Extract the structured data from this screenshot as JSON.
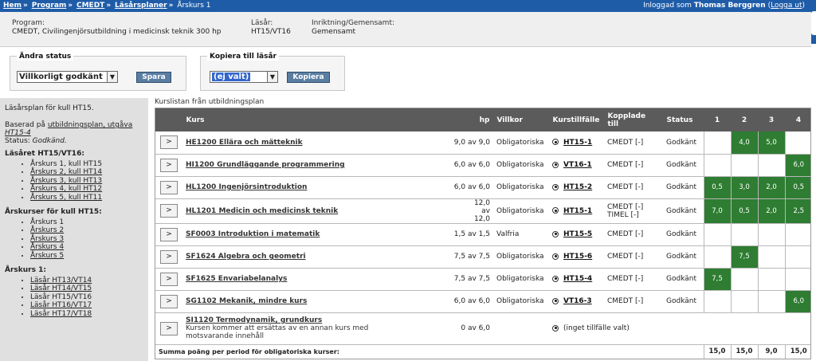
{
  "breadcrumb": {
    "home": "Hem",
    "program": "Program",
    "cmedt": "CMEDT",
    "plans": "Läsårsplaner",
    "current": "Årskurs 1",
    "separator": "»"
  },
  "login": {
    "prefix": "Inloggad som",
    "user": "Thomas Berggren",
    "logout": "Logga ut"
  },
  "info": {
    "program_label": "Program:",
    "program_value": "CMEDT, Civilingenjörsutbildning i medicinsk teknik 300 hp",
    "year_label": "Läsår:",
    "year_value": "HT15/VT16",
    "direction_label": "Inriktning/Gemensamt:",
    "direction_value": "Gemensamt"
  },
  "status_box": {
    "legend": "Ändra status",
    "selected": "Villkorligt godkänt",
    "button": "Spara"
  },
  "copy_box": {
    "legend": "Kopiera till läsår",
    "selected": "(ej valt)",
    "button": "Kopiera"
  },
  "sidebar": {
    "plan_for": "Läsårsplan för kull HT15.",
    "based_on": "Baserad på",
    "based_link": "utbildningsplan, utgåva",
    "based_version": "HT15-4",
    "status_label": "Status:",
    "status_value": "Godkänd.",
    "year_heading": "Läsåret HT15/VT16:",
    "year_items": [
      "Årskurs 1, kull HT15",
      "Årskurs 2, kull HT14",
      "Årskurs 3, kull HT13",
      "Årskurs 4, kull HT12",
      "Årskurs 5, kull HT11"
    ],
    "class_heading": "Årskurser för kull HT15:",
    "class_items": [
      "Årskurs 1",
      "Årskurs 2",
      "Årskurs 3",
      "Årskurs 4",
      "Årskurs 5"
    ],
    "ak1_heading": "Årskurs 1:",
    "ak1_items": [
      "Läsår HT13/VT14",
      "Läsår HT14/VT15",
      "Läsår HT15/VT16",
      "Läsår HT16/VT17",
      "Läsår HT17/VT18"
    ]
  },
  "main": {
    "title": "Kurslistan från utbildningsplan",
    "headers": {
      "kurs": "Kurs",
      "hp": "hp",
      "villkor": "Villkor",
      "tillfalle": "Kurstillfälle",
      "kopplade_1": "Kopplade",
      "kopplade_2": "till",
      "status": "Status",
      "p1": "1",
      "p2": "2",
      "p3": "3",
      "p4": "4"
    },
    "expand_label": ">",
    "rows": [
      {
        "code": "HE1200 Ellära och mätteknik",
        "hp": "9,0 av 9,0",
        "villkor": "Obligatoriska",
        "tillfalle": "HT15-1",
        "kopplade": "CMEDT [-]",
        "status": "Godkänt",
        "p": [
          "",
          "4,0",
          "5,0",
          ""
        ]
      },
      {
        "code": "HI1200 Grundläggande programmering",
        "hp": "6,0 av 6,0",
        "villkor": "Obligatoriska",
        "tillfalle": "VT16-1",
        "kopplade": "CMEDT [-]",
        "status": "Godkänt",
        "p": [
          "",
          "",
          "",
          "6,0"
        ]
      },
      {
        "code": "HL1200 Ingenjörsintroduktion",
        "hp": "6,0 av 6,0",
        "villkor": "Obligatoriska",
        "tillfalle": "HT15-2",
        "kopplade": "CMEDT [-]",
        "status": "Godkänt",
        "p": [
          "0,5",
          "3,0",
          "2,0",
          "0,5"
        ]
      },
      {
        "code": "HL1201 Medicin och medicinsk teknik",
        "hp": "12,0 av 12,0",
        "villkor": "Obligatoriska",
        "tillfalle": "HT15-1",
        "kopplade": "CMEDT [-]",
        "kopplade2": "TIMEL [-]",
        "status": "Godkänt",
        "p": [
          "7,0",
          "0,5",
          "2,0",
          "2,5"
        ]
      },
      {
        "code": "SF0003 Introduktion i matematik",
        "hp": "1,5 av 1,5",
        "villkor": "Valfria",
        "tillfalle": "HT15-5",
        "kopplade": "CMEDT [-]",
        "status": "Godkänt",
        "p": [
          "",
          "",
          "",
          ""
        ]
      },
      {
        "code": "SF1624 Algebra och geometri",
        "hp": "7,5 av 7,5",
        "villkor": "Obligatoriska",
        "tillfalle": "HT15-6",
        "kopplade": "CMEDT [-]",
        "status": "Godkänt",
        "p": [
          "",
          "7,5",
          "",
          ""
        ]
      },
      {
        "code": "SF1625 Envariabelanalys",
        "hp": "7,5 av 7,5",
        "villkor": "Obligatoriska",
        "tillfalle": "HT15-4",
        "kopplade": "CMEDT [-]",
        "status": "Godkänt",
        "p": [
          "7,5",
          "",
          "",
          ""
        ]
      },
      {
        "code": "SG1102 Mekanik, mindre kurs",
        "hp": "6,0 av 6,0",
        "villkor": "Obligatoriska",
        "tillfalle": "VT16-3",
        "kopplade": "CMEDT [-]",
        "status": "Godkänt",
        "p": [
          "",
          "",
          "",
          "6,0"
        ]
      },
      {
        "code": "SI1120 Termodynamik, grundkurs",
        "note": "Kursen kommer att ersättas av en annan kurs med motsvarande innehåll",
        "hp": "0 av 6,0",
        "villkor": "",
        "tillfalle": "(inget tillfälle valt)",
        "kopplade": "",
        "status": "",
        "p": null
      }
    ],
    "sum_label": "Summa poäng per period för obligatoriska kurser:",
    "sums": [
      "15,0",
      "15,0",
      "9,0",
      "15,0"
    ]
  },
  "colors": {
    "topbar": "#1e5ca8",
    "header_row": "#5b5b5b",
    "period_green": "#2e7d32",
    "button": "#5a7ea2",
    "sidebar": "#e0e0e0"
  }
}
